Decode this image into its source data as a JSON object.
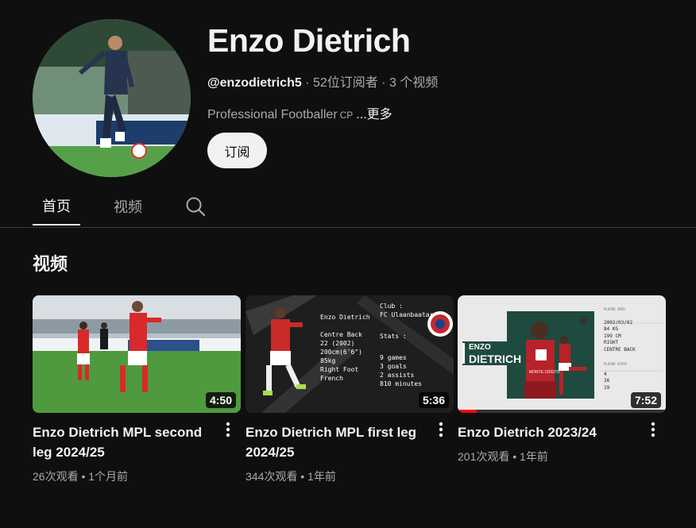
{
  "channel": {
    "name": "Enzo Dietrich",
    "handle": "@enzodietrich5",
    "subscribers": "52位订阅者",
    "videos_count": "3 个视频",
    "description": "Professional Footballer",
    "description_ext": "CP",
    "more_label": "...更多",
    "subscribe_label": "订阅"
  },
  "tabs": [
    {
      "label": "首页",
      "active": true
    },
    {
      "label": "视频",
      "active": false
    }
  ],
  "section": {
    "title": "视频"
  },
  "videos": [
    {
      "title": "Enzo Dietrich MPL second leg 2024/25",
      "duration": "4:50",
      "views": "26次观看",
      "age": "1个月前"
    },
    {
      "title": "Enzo Dietrich MPL first leg 2024/25",
      "duration": "5:36",
      "views": "344次观看",
      "age": "1年前",
      "thumb_text": {
        "name": "Enzo Dietrich",
        "club_label": "Club :",
        "club": "FC Ulaanbaatar",
        "position": "Centre Back",
        "born": "22 (2002)",
        "height": "200cm(6'6\")",
        "weight": "85kg",
        "foot": "Right Foot",
        "nation": "French",
        "stats_label": "Stats :",
        "games": "9 games",
        "goals": "3 goals",
        "assists": "2 assists",
        "minutes": "810 minutes"
      }
    },
    {
      "title": "Enzo Dietrich 2023/24",
      "duration": "7:52",
      "views": "201次观看",
      "age": "1年前",
      "progress": 0.09,
      "thumb_text": {
        "first": "ENZO",
        "last": "DIETRICH",
        "club": "MONTE CRISTO",
        "info_header": "PLAYER INFO",
        "dob": "2002/03/02",
        "weight": "84 KG",
        "height": "199 CM",
        "foot": "RIGHT",
        "position": "CENTRE BACK",
        "stats_header": "PLAYER STATS",
        "goals": "4",
        "games": "26",
        "minutes": "19"
      }
    }
  ],
  "colors": {
    "background": "#0f0f0f",
    "text_primary": "#f1f1f1",
    "text_secondary": "#aaaaaa",
    "progress": "#ff0000"
  },
  "icons": {
    "search": "search-icon",
    "more": "more-vertical-icon"
  }
}
